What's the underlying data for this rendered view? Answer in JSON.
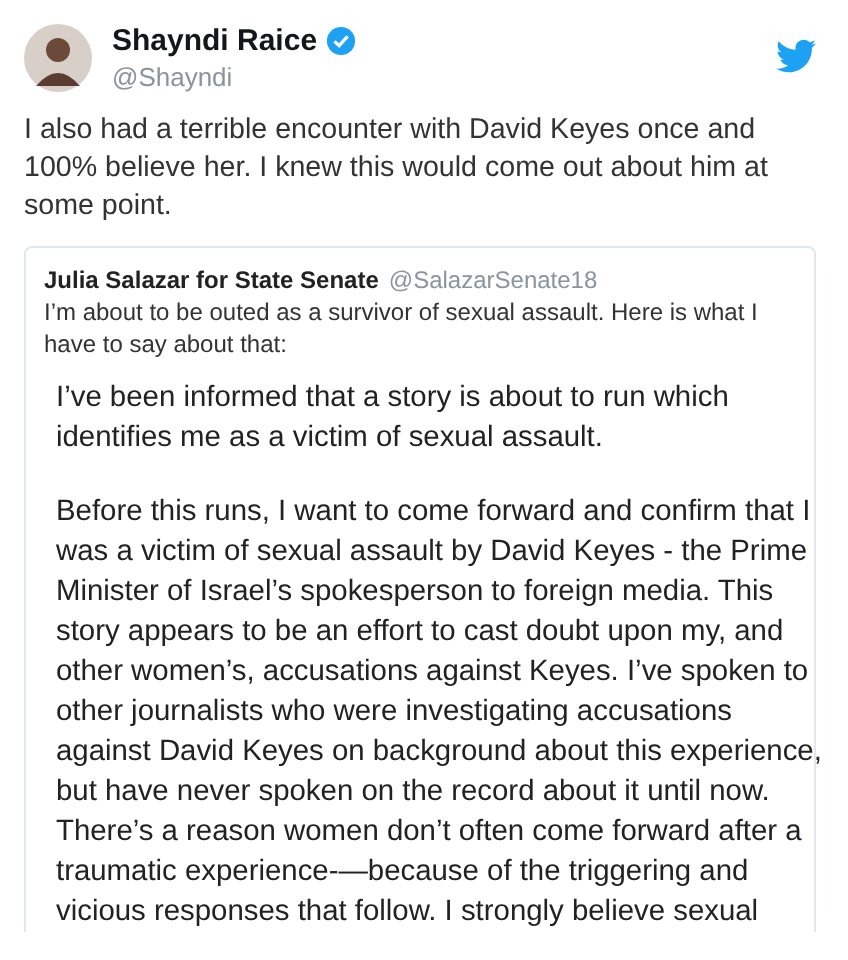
{
  "tweet": {
    "author": {
      "name": "Shayndi Raice",
      "handle": "@Shayndi",
      "verified": true
    },
    "text": "I also had a terrible encounter with David Keyes once and 100% believe her. I knew this would come out about him at some point.",
    "quoted": {
      "author": {
        "name": "Julia Salazar for State Senate",
        "handle": "@SalazarSenate18"
      },
      "text": "I’m about to be outed as a survivor of sexual assault. Here is what I have to say about that:",
      "statement": [
        {
          "lines": [
            "I’ve been informed that a story is about to run which",
            "identifies me as a victim of sexual assault."
          ]
        },
        {
          "lines": [
            "Before this runs, I want to come forward and confirm that I",
            "was a victim of sexual assault by David Keyes - the Prime",
            "Minister of Israel’s spokesperson to foreign media. This",
            "story appears to be an effort to cast doubt upon my, and",
            "other women’s, accusations against Keyes. I’ve spoken to",
            "other journalists who were investigating accusations",
            "against David Keyes on background about this experience,",
            "but have never spoken on the record about it until now.",
            "There’s a reason women don’t often come forward after a",
            "traumatic experience-—because of the triggering and",
            "vicious responses that follow. I strongly believe sexual"
          ]
        }
      ]
    }
  }
}
